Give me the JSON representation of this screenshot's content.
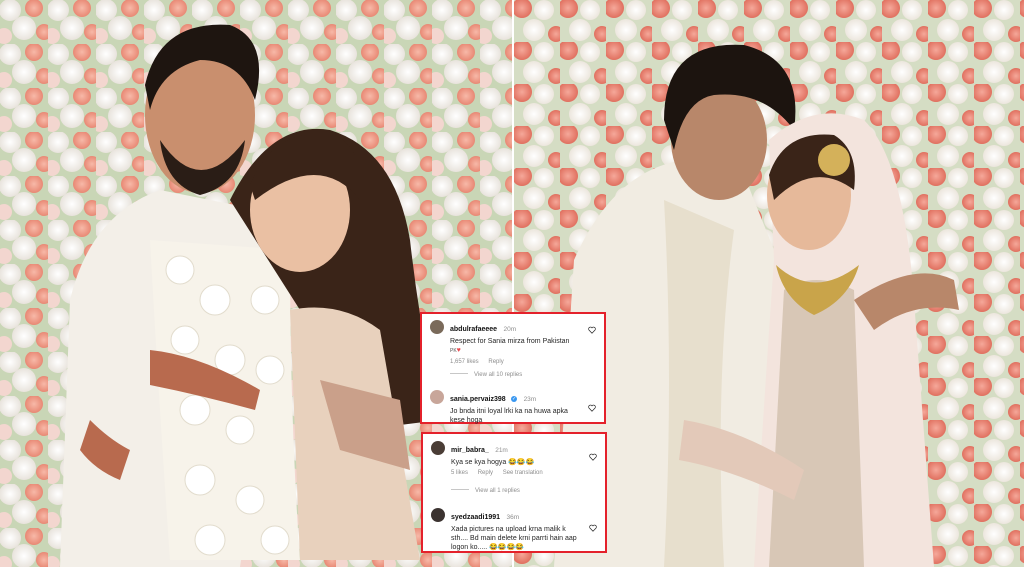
{
  "comments_panel_1": {
    "comments": [
      {
        "username": "abdulrafaeeee",
        "time": "20m",
        "text": "Respect for Sania mirza from Pakistan ",
        "flag_text": "PK",
        "likes": "1,657 likes",
        "reply_label": "Reply"
      },
      {
        "username": "sania.pervaiz398",
        "time": "23m",
        "text": "Jo bnda itni loyal lrki ka na huwa apka kese hoga",
        "likes": "",
        "reply_label": ""
      }
    ],
    "view_replies": "View all 10 replies"
  },
  "comments_panel_2": {
    "comments": [
      {
        "username": "mir_babra_",
        "time": "21m",
        "text": "Kya se kya hogya 😂😂😂",
        "likes": "5 likes",
        "reply_label": "Reply",
        "translation": "See translation"
      },
      {
        "username": "syedzaadi1991",
        "time": "36m",
        "text": "Xada pictures na upload krna malik k sth.... Bd main delete krni parrti hain aap logon ko..... 😂😂😂😂"
      }
    ],
    "view_replies": "View all 1 replies"
  },
  "colors": {
    "highlight_border": "#e4212b",
    "verified": "#3897f0",
    "muted_text": "#8e8e8e"
  }
}
